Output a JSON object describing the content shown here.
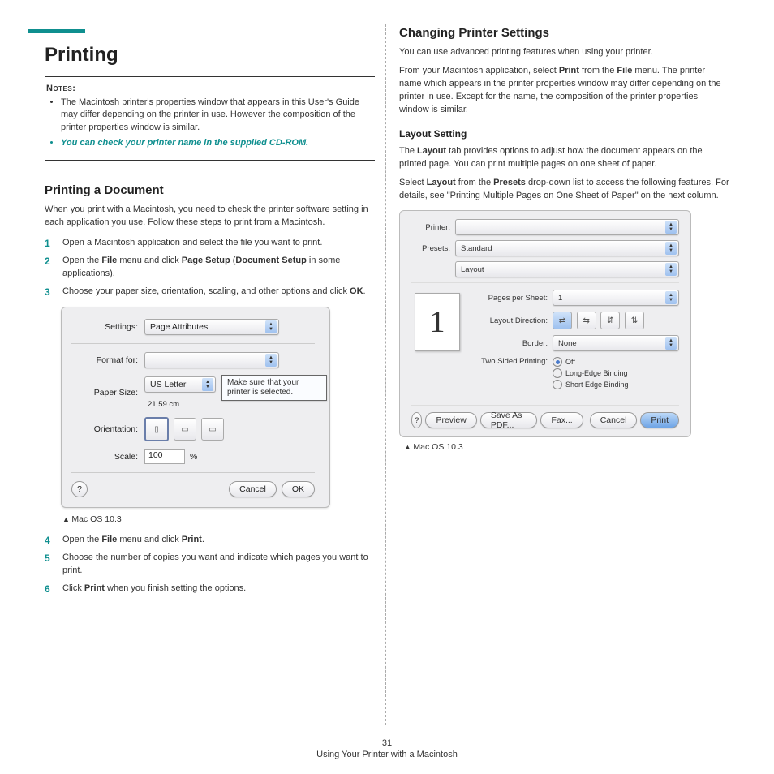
{
  "col1": {
    "title": "Printing",
    "notes_label": "Notes",
    "note1": "The Macintosh printer's properties window that appears in this User's Guide may differ depending on the printer in use. However the composition of the printer properties window is similar.",
    "note2": "You can check your printer name in the supplied CD-ROM.",
    "sec1_title": "Printing a Document",
    "sec1_intro": "When you print with a Macintosh, you need to check the printer software setting in each application you use. Follow these steps to print from a Macintosh.",
    "step1": "Open a Macintosh application and select the file you want to print.",
    "step2a": "Open the ",
    "step2b": "File",
    "step2c": " menu and click ",
    "step2d": "Page Setup",
    "step2e": " (",
    "step2f": "Document Setup",
    "step2g": " in some applications).",
    "step3a": "Choose your paper size, orientation, scaling, and other options and click ",
    "step3b": "OK",
    "step3c": ".",
    "dlg1": {
      "settings_label": "Settings:",
      "settings_val": "Page Attributes",
      "format_label": "Format for:",
      "paper_label": "Paper Size:",
      "paper_val": "US Letter",
      "paper_dim": "21.59 cm",
      "orient_label": "Orientation:",
      "scale_label": "Scale:",
      "scale_val": "100",
      "scale_unit": "%",
      "cancel": "Cancel",
      "ok": "OK",
      "help": "?",
      "callout": "Make sure that your printer is selected."
    },
    "caption1": "Mac OS 10.3",
    "step4a": "Open the ",
    "step4b": "File",
    "step4c": " menu and click ",
    "step4d": "Print",
    "step4e": ".",
    "step5": "Choose the number of copies you want and indicate which pages you want to print.",
    "step6a": "Click ",
    "step6b": "Print",
    "step6c": " when you finish setting the options."
  },
  "col2": {
    "title": "Changing Printer Settings",
    "p1": "You can use advanced printing features when using your printer.",
    "p2a": "From your Macintosh application, select ",
    "p2b": "Print",
    "p2c": " from the ",
    "p2d": "File",
    "p2e": " menu. The printer name which appears in the printer properties window may differ depending on the printer in use. Except for the name, the composition of the printer properties window is similar.",
    "sub1": "Layout Setting",
    "p3a": "The ",
    "p3b": "Layout",
    "p3c": " tab provides options to adjust how the document appears on the printed page. You can print multiple pages on one sheet of paper.",
    "p4a": "Select ",
    "p4b": "Layout",
    "p4c": " from the ",
    "p4d": "Presets",
    "p4e": " drop-down list to access the following features. For details, see \"Printing Multiple Pages on One Sheet of Paper\" on the next column.",
    "dlg2": {
      "printer_label": "Printer:",
      "presets_label": "Presets:",
      "presets_val": "Standard",
      "tab_val": "Layout",
      "pps_label": "Pages per Sheet:",
      "pps_val": "1",
      "dir_label": "Layout Direction:",
      "border_label": "Border:",
      "border_val": "None",
      "two_label": "Two Sided Printing:",
      "opt_off": "Off",
      "opt_long": "Long-Edge Binding",
      "opt_short": "Short Edge Binding",
      "help": "?",
      "preview_num": "1",
      "btn_preview": "Preview",
      "btn_pdf": "Save As PDF...",
      "btn_fax": "Fax...",
      "btn_cancel": "Cancel",
      "btn_print": "Print"
    },
    "caption2": "Mac OS 10.3"
  },
  "footer": {
    "page": "31",
    "text": "Using Your Printer with a Macintosh"
  }
}
